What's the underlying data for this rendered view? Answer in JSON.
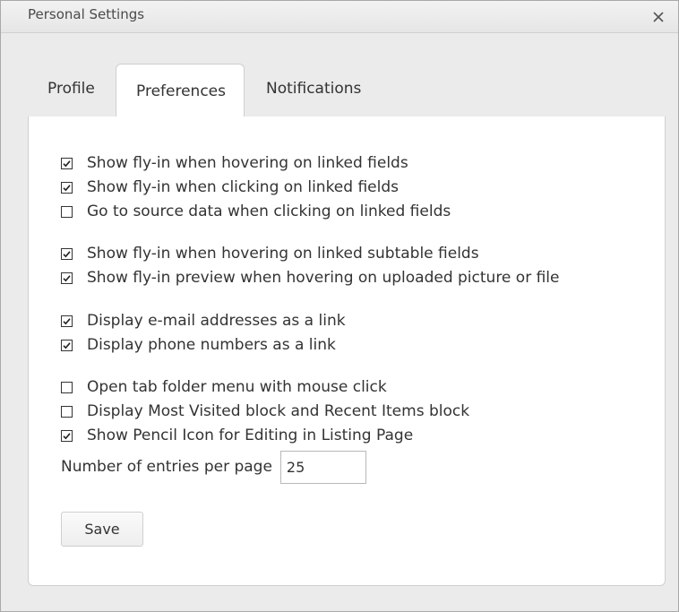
{
  "dialog": {
    "title": "Personal Settings",
    "close_icon": "close-icon"
  },
  "tabs": [
    {
      "label": "Profile",
      "active": false
    },
    {
      "label": "Preferences",
      "active": true
    },
    {
      "label": "Notifications",
      "active": false
    }
  ],
  "options": [
    {
      "label": "Show fly-in when hovering on linked fields",
      "checked": true
    },
    {
      "label": "Show fly-in when clicking on linked fields",
      "checked": true
    },
    {
      "label": "Go to source data when clicking on linked fields",
      "checked": false
    },
    {
      "label": "Show fly-in when hovering on linked subtable fields",
      "checked": true
    },
    {
      "label": "Show fly-in preview when hovering on uploaded picture or file",
      "checked": true
    },
    {
      "label": "Display e-mail addresses as a link",
      "checked": true
    },
    {
      "label": "Display phone numbers as a link",
      "checked": true
    },
    {
      "label": "Open tab folder menu with mouse click",
      "checked": false
    },
    {
      "label": "Display Most Visited block and Recent Items block",
      "checked": false
    },
    {
      "label": "Show Pencil Icon for Editing in Listing Page",
      "checked": true
    }
  ],
  "entries": {
    "label": "Number of entries per page",
    "value": "25"
  },
  "save_label": "Save"
}
